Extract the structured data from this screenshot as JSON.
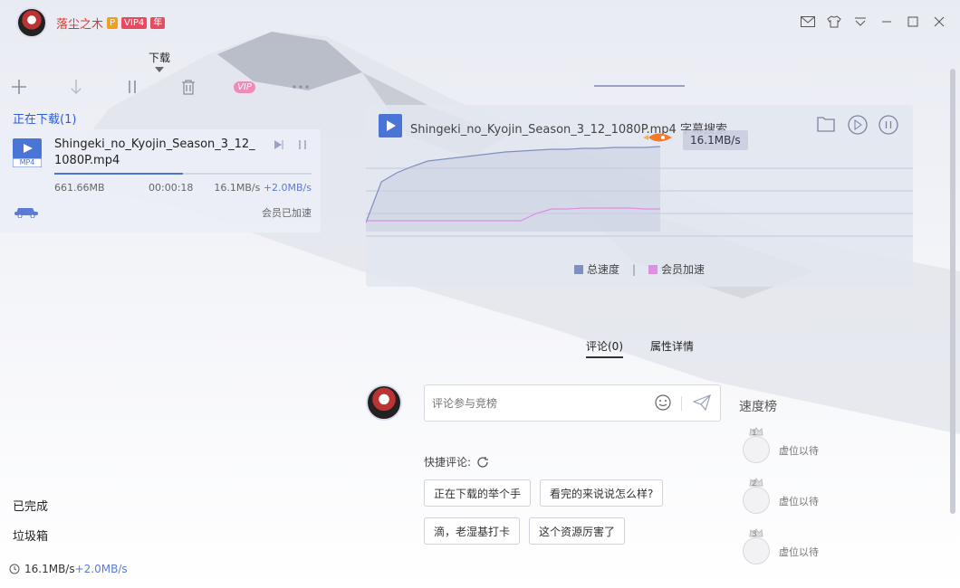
{
  "user": {
    "name": "落尘之木",
    "badge_p": "P",
    "badge_vip": "VIP4",
    "badge_year": "年"
  },
  "toolbar": {
    "tab_label": "下载",
    "vip_label": "VIP"
  },
  "downloading": {
    "section_title": "正在下载(1)",
    "item": {
      "file_type": "MP4",
      "name": "Shingeki_no_Kyojin_Season_3_12_1080P.mp4",
      "size": "661.66MB",
      "time": "00:00:18",
      "speed": "16.1MB/s",
      "boost": "+2.0MB/s",
      "progress": 0.5,
      "member_status": "会员已加速"
    }
  },
  "sidebar": {
    "completed": "已完成",
    "trash": "垃圾箱"
  },
  "status_bar": {
    "speed": "16.1MB/s",
    "boost": "+2.0MB/s"
  },
  "detail": {
    "file_name": "Shingeki_no_Kyojin_Season_3_12_1080P.mp4",
    "subtitle_search": "字幕搜索",
    "current_speed": "16.1MB/s"
  },
  "chart_data": {
    "type": "area",
    "series": [
      {
        "name": "总速度",
        "color": "#7f8fc0",
        "values": [
          0.1,
          0.55,
          0.65,
          0.72,
          0.78,
          0.8,
          0.82,
          0.84,
          0.86,
          0.88,
          0.89,
          0.9,
          0.91,
          0.91,
          0.92,
          0.92,
          0.93,
          0.93,
          0.93,
          0.94
        ]
      },
      {
        "name": "会员加速",
        "color": "#e08fe0",
        "values": [
          0.12,
          0.12,
          0.12,
          0.12,
          0.12,
          0.12,
          0.12,
          0.12,
          0.12,
          0.12,
          0.12,
          0.2,
          0.25,
          0.25,
          0.26,
          0.26,
          0.26,
          0.26,
          0.25,
          0.25
        ]
      }
    ],
    "legend_placement": "bottom",
    "grid": true
  },
  "detail_tabs": {
    "comments": "评论(0)",
    "properties": "属性详情"
  },
  "comment": {
    "placeholder": "评论参与竞榜",
    "quick_label": "快捷评论:",
    "quick_options": [
      "正在下载的举个手",
      "看完的来说说怎么样?",
      "滴，老湿基打卡",
      "这个资源厉害了"
    ]
  },
  "ranking": {
    "title": "速度榜",
    "items": [
      {
        "rank": "1",
        "text": "虚位以待"
      },
      {
        "rank": "2",
        "text": "虚位以待"
      },
      {
        "rank": "3",
        "text": "虚位以待"
      }
    ]
  }
}
